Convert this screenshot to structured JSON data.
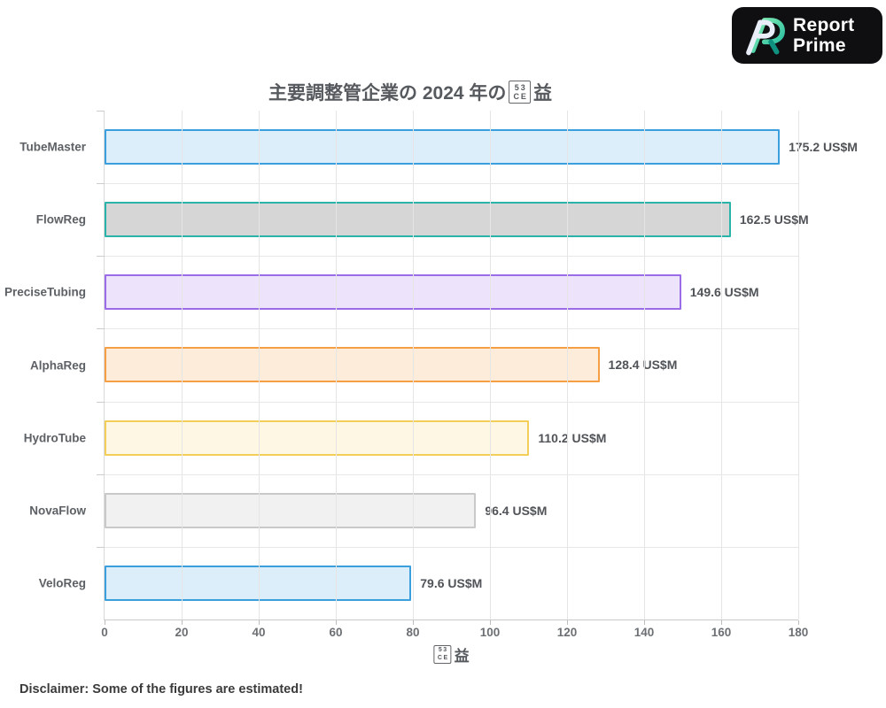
{
  "logo": {
    "line1": "Report",
    "line2": "Prime",
    "bg_color": "#0f0f12",
    "text_color": "#ffffff",
    "mark_colors": {
      "mint": "#8df0b6",
      "teal": "#1db89d",
      "dark_teal": "#0f9180",
      "light": "#e9edf8"
    }
  },
  "chart_data": {
    "type": "bar",
    "orientation": "horizontal",
    "title": {
      "prefix": "主要調整管企業の 2024 年の",
      "missing_glyph": {
        "row1": "53",
        "row2": "CE"
      },
      "suffix": "益"
    },
    "categories": [
      "TubeMaster",
      "FlowReg",
      "PreciseTubing",
      "AlphaReg",
      "HydroTube",
      "NovaFlow",
      "VeloReg"
    ],
    "values": [
      175.2,
      162.5,
      149.6,
      128.4,
      110.2,
      96.4,
      79.6
    ],
    "value_labels": [
      "175.2 US$M",
      "162.5 US$M",
      "149.6 US$M",
      "128.4 US$M",
      "110.2 US$M",
      "96.4 US$M",
      "79.6 US$M"
    ],
    "unit": "US$M",
    "xlabel": {
      "missing_glyph": {
        "row1": "53",
        "row2": "CE"
      },
      "suffix": "益"
    },
    "xlim": [
      0,
      180
    ],
    "x_ticks": [
      0,
      20,
      40,
      60,
      80,
      100,
      120,
      140,
      160,
      180
    ],
    "grid": true,
    "legend": false,
    "bar_style": [
      {
        "fill": "rgba(58,159,220,0.18)",
        "border": "#3a9fdc"
      },
      {
        "fill": "rgba(70,70,70,0.22)",
        "border": "#2ab3a8"
      },
      {
        "fill": "rgba(155,108,232,0.18)",
        "border": "#9b6ce8"
      },
      {
        "fill": "rgba(245,158,68,0.20)",
        "border": "#f59e44"
      },
      {
        "fill": "rgba(243,207,78,0.16)",
        "border": "#f3cf5a"
      },
      {
        "fill": "rgba(0,0,0,0.055)",
        "border": "#c9c9c9"
      },
      {
        "fill": "rgba(58,159,220,0.18)",
        "border": "#3a9fdc"
      }
    ]
  },
  "footer": {
    "disclaimer": "Disclaimer: Some of the figures are estimated!"
  }
}
